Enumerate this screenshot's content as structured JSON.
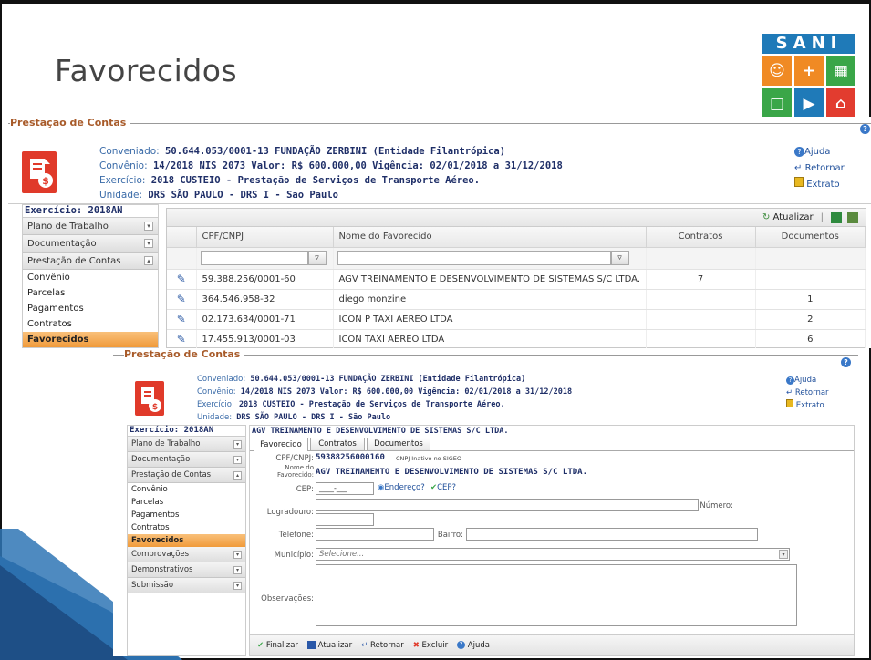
{
  "slide_title": "Favorecidos",
  "logo": {
    "word": "SANI",
    "colors": {
      "blue": "#1f7ab8",
      "orange": "#f08a24",
      "green": "#3aa648",
      "red": "#e23c2f"
    }
  },
  "shot1": {
    "legend": "Prestação de Contas",
    "labels": {
      "conveniado": "Conveniado:",
      "convenio": "Convênio:",
      "exercicio": "Exercício:",
      "unidade": "Unidade:"
    },
    "conveniado": "50.644.053/0001-13  FUNDAÇÃO ZERBINI  (Entidade Filantrópica)",
    "convenio": "14/2018 NIS 2073 Valor: R$ 600.000,00 Vigência: 02/01/2018 a 31/12/2018",
    "exercicio": "2018  CUSTEIO - Prestação de Serviços de Transporte Aéreo.",
    "unidade": "DRS SÃO PAULO - DRS I - São Paulo",
    "links": {
      "ajuda": "Ajuda",
      "retornar": "Retornar",
      "extrato": "Extrato"
    },
    "sidebar": {
      "header": "Exercício: 2018AN",
      "groups": [
        "Plano de Trabalho",
        "Documentação",
        "Prestação de Contas"
      ],
      "items": [
        "Convênio",
        "Parcelas",
        "Pagamentos",
        "Contratos",
        "Favorecidos"
      ]
    },
    "grid": {
      "atualizar": "Atualizar",
      "columns": [
        "CPF/CNPJ",
        "Nome do Favorecido",
        "Contratos",
        "Documentos"
      ],
      "rows": [
        {
          "cpf": "59.388.256/0001-60",
          "nome": "AGV TREINAMENTO E DESENVOLVIMENTO DE SISTEMAS S/C LTDA.",
          "contratos": "7",
          "documentos": ""
        },
        {
          "cpf": "364.546.958-32",
          "nome": "diego monzine",
          "contratos": "",
          "documentos": "1"
        },
        {
          "cpf": "02.173.634/0001-71",
          "nome": "ICON P TAXI AEREO LTDA",
          "contratos": "",
          "documentos": "2"
        },
        {
          "cpf": "17.455.913/0001-03",
          "nome": "ICON TAXI AEREO LTDA",
          "contratos": "",
          "documentos": "6"
        }
      ]
    }
  },
  "shot2": {
    "legend": "Prestação de Contas",
    "labels": {
      "conveniado": "Conveniado:",
      "convenio": "Convênio:",
      "exercicio": "Exercício:",
      "unidade": "Unidade:"
    },
    "conveniado": "50.644.053/0001-13  FUNDAÇÃO ZERBINI  (Entidade Filantrópica)",
    "convenio": "14/2018 NIS 2073 Valor: R$ 600.000,00 Vigência: 02/01/2018 a 31/12/2018",
    "exercicio": "2018  CUSTEIO - Prestação de Serviços de Transporte Aéreo.",
    "unidade": "DRS SÃO PAULO - DRS I - São Paulo",
    "links": {
      "ajuda": "Ajuda",
      "retornar": "Retornar",
      "extrato": "Extrato"
    },
    "sidebar": {
      "header": "Exercício: 2018AN",
      "groups_top": [
        "Plano de Trabalho",
        "Documentação",
        "Prestação de Contas"
      ],
      "items": [
        "Convênio",
        "Parcelas",
        "Pagamentos",
        "Contratos",
        "Favorecidos"
      ],
      "groups_bottom": [
        "Comprovações",
        "Demonstrativos",
        "Submissão"
      ]
    },
    "panel_title": "AGV TREINAMENTO E DESENVOLVIMENTO DE SISTEMAS S/C LTDA.",
    "tabs": [
      "Favorecido",
      "Contratos",
      "Documentos"
    ],
    "form": {
      "cpf_label": "CPF/CNPJ:",
      "cpf_value": "59388256000160",
      "cpf_note": "CNPJ Inativo no SIGEO",
      "nome_label": "Nome do Favorecido:",
      "nome_value": "AGV TREINAMENTO E DESENVOLVIMENTO DE SISTEMAS S/C LTDA.",
      "cep_label": "CEP:",
      "cep_value": "____-___",
      "endereco_link": "Endereço?",
      "cep_link": "CEP?",
      "logradouro_label": "Logradouro:",
      "numero_label": "Número:",
      "telefone_label": "Telefone:",
      "bairro_label": "Bairro:",
      "municipio_label": "Município:",
      "municipio_placeholder": "Selecione...",
      "observacoes_label": "Observações:"
    },
    "buttons": [
      "Finalizar",
      "Atualizar",
      "Retornar",
      "Excluir",
      "Ajuda"
    ]
  }
}
